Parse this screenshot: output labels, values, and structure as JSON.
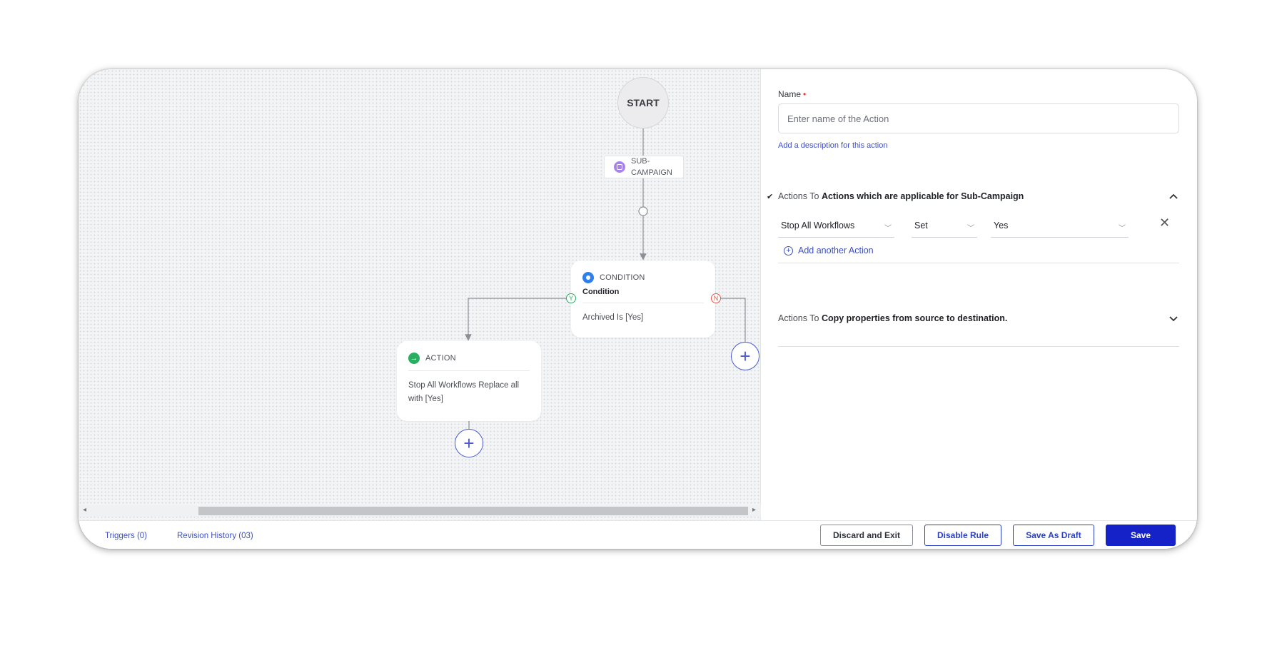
{
  "canvas": {
    "start_label": "START",
    "sub_campaign_label": "SUB-CAMPAIGN",
    "condition_card": {
      "type_label": "CONDITION",
      "title": "Condition",
      "body": "Archived Is [Yes]"
    },
    "action_card": {
      "type_label": "ACTION",
      "body": "Stop All Workflows Replace all with [Yes]"
    },
    "branch_yes": "Y",
    "branch_no": "N",
    "add_icon": "plus-icon"
  },
  "panel": {
    "name_label": "Name",
    "required_mark": "•",
    "name_placeholder": "Enter name of the Action",
    "add_description": "Add a description for this action",
    "section1": {
      "prefix": "Actions To",
      "title": "Actions which are applicable for Sub-Campaign",
      "expanded": true
    },
    "action_row": {
      "field": "Stop All Workflows",
      "operator": "Set",
      "value": "Yes"
    },
    "add_another": "Add another Action",
    "section2": {
      "prefix": "Actions To",
      "title": "Copy properties from source to destination.",
      "expanded": false
    }
  },
  "footer": {
    "triggers": "Triggers (0)",
    "revision_history": "Revision History (03)",
    "discard": "Discard and Exit",
    "disable": "Disable Rule",
    "save_draft": "Save As Draft",
    "save": "Save"
  },
  "colors": {
    "primary": "#1422c8",
    "link": "#3d4fc4",
    "condition_icon": "#2f80ed",
    "action_icon": "#27ae60",
    "sub_campaign_icon": "#a883ea",
    "no_branch": "#e05a4a"
  }
}
